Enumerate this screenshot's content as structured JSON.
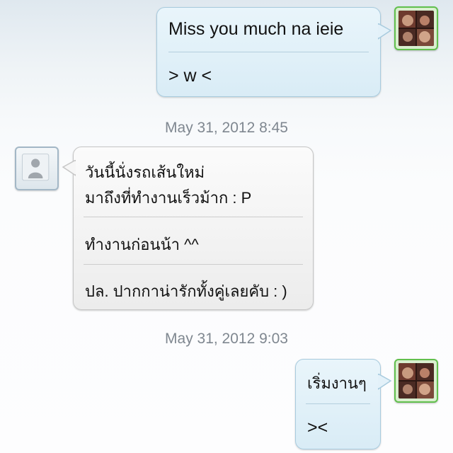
{
  "conversation": {
    "group1": {
      "messages": [
        "Miss you much na ieie",
        "> w <"
      ]
    },
    "timestamp1": "May 31, 2012 8:45",
    "group2": {
      "messages": [
        "วันนี้นั่งรถเส้นใหม่",
        "มาถึงที่ทำงานเร็วม้าก : P",
        "ทำงานก่อนน้า ^^",
        "ปล. ปากกาน่ารักทั้งคู่เลยคับ : )"
      ]
    },
    "timestamp2": "May 31, 2012 9:03",
    "group3": {
      "messages": [
        "เริ่มงานๆ",
        "><"
      ]
    }
  },
  "avatars": {
    "friend_border_color": "#61c04d",
    "default_avatar_icon": "person-silhouette-icon"
  },
  "colors": {
    "outgoing_bubble": "#dcedf7",
    "incoming_bubble": "#f0f0f0",
    "timestamp_text": "#7f8790"
  }
}
